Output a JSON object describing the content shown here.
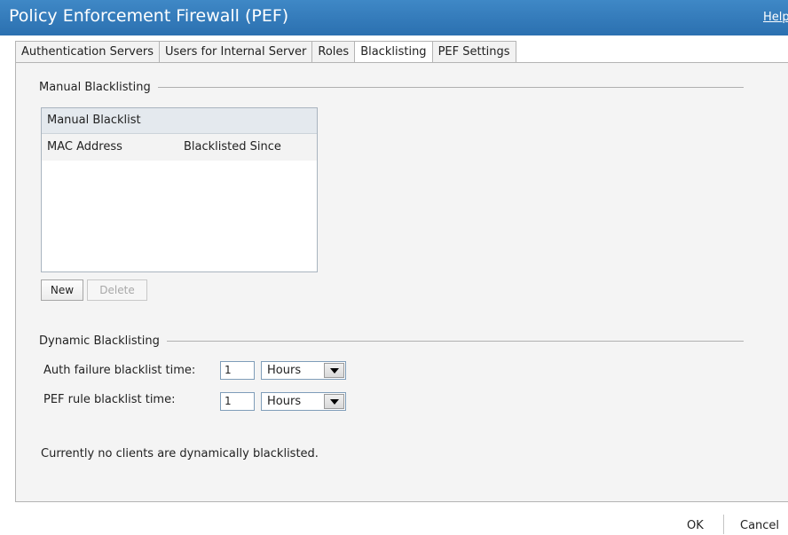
{
  "window": {
    "title": "Policy Enforcement Firewall (PEF)",
    "help_label": "Help"
  },
  "tabs": [
    {
      "label": "Authentication Servers",
      "active": false
    },
    {
      "label": "Users for Internal Server",
      "active": false
    },
    {
      "label": "Roles",
      "active": false
    },
    {
      "label": "Blacklisting",
      "active": true
    },
    {
      "label": "PEF Settings",
      "active": false
    }
  ],
  "manual": {
    "section_title": "Manual Blacklisting",
    "list_title": "Manual Blacklist",
    "columns": [
      "MAC Address",
      "Blacklisted Since"
    ],
    "new_label": "New",
    "delete_label": "Delete"
  },
  "dynamic": {
    "section_title": "Dynamic Blacklisting",
    "auth_label": "Auth failure blacklist time:",
    "auth_value": "1",
    "auth_unit": "Hours",
    "pef_label": "PEF rule blacklist time:",
    "pef_value": "1",
    "pef_unit": "Hours",
    "status": "Currently no clients are dynamically blacklisted."
  },
  "footer": {
    "ok_label": "OK",
    "cancel_label": "Cancel"
  }
}
